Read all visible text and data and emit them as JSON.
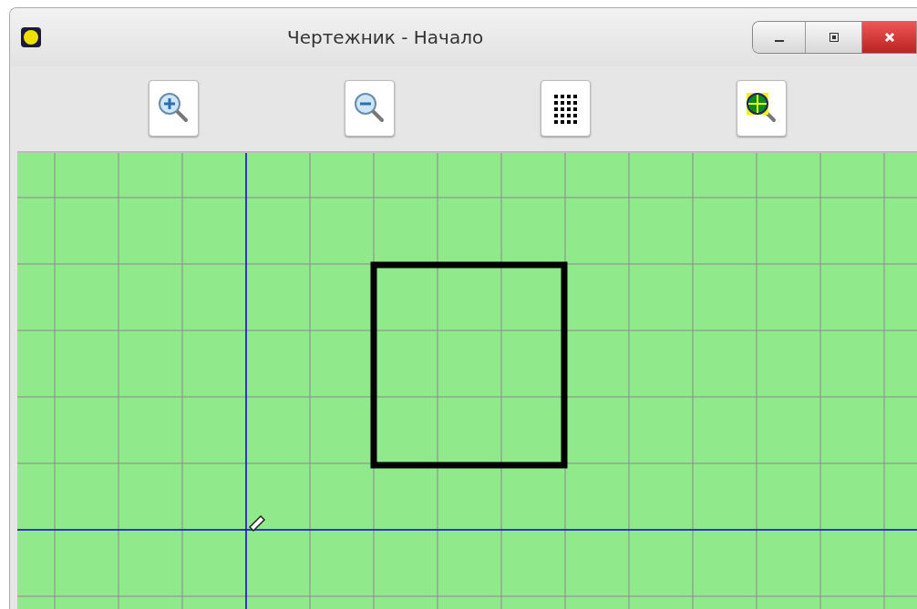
{
  "window": {
    "title": "Чертежник - Начало",
    "controls": [
      {
        "kind": "minimize"
      },
      {
        "kind": "maximize"
      },
      {
        "kind": "close"
      }
    ]
  },
  "toolbar": [
    {
      "kind": "zoom-in"
    },
    {
      "kind": "zoom-out"
    },
    {
      "kind": "grid"
    },
    {
      "kind": "fit"
    }
  ]
}
